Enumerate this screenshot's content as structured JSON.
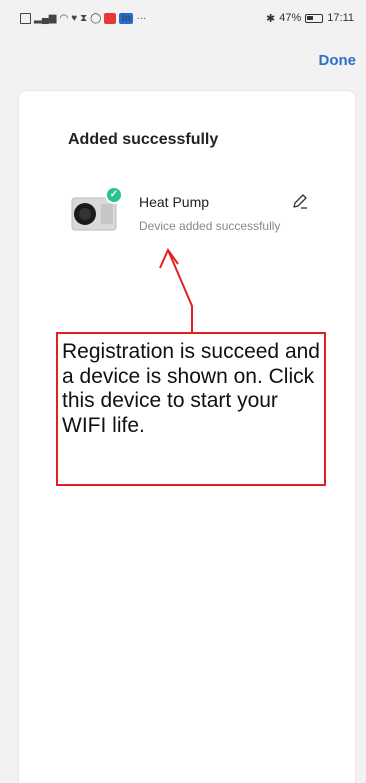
{
  "status_bar": {
    "battery": "47%",
    "time": "17:11",
    "icons": [
      "hd-icon",
      "signal-icon",
      "wifi-icon",
      "heart-icon",
      "hourglass-icon",
      "whatsapp-icon",
      "red-app-icon",
      "linkedin-icon",
      "more-icon",
      "bluetooth-icon",
      "battery-icon"
    ],
    "linkedin_text": "in",
    "more_text": "···",
    "bluetooth_text": "✱"
  },
  "header": {
    "done_label": "Done"
  },
  "card": {
    "title": "Added successfully",
    "device": {
      "name": "Heat Pump",
      "status": "Device added successfully",
      "icon": "heat-pump-device-icon",
      "badge_icon": "check-icon"
    }
  },
  "annotation": {
    "text": "Registration is succeed and a device is shown on. Click this device to start your WIFI life.",
    "color": "#e32020"
  },
  "colors": {
    "accent": "#2d6fc9",
    "success": "#29c28a"
  }
}
